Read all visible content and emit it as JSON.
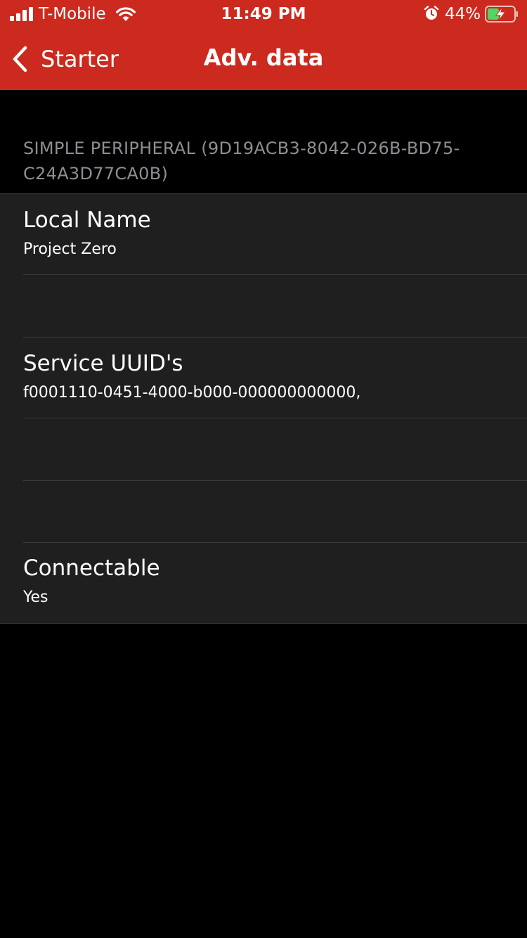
{
  "status_bar": {
    "carrier": "T-Mobile",
    "time": "11:49 PM",
    "battery_percent": "44%",
    "battery_level": 0.44,
    "icons": [
      "signal-icon",
      "wifi-icon",
      "alarm-icon",
      "battery-charging-icon"
    ]
  },
  "nav": {
    "back_label": "Starter",
    "title": "Adv. data"
  },
  "section": {
    "header_line1": "SIMPLE PERIPHERAL (9D19ACB3-8042-026B-BD75-",
    "header_line2": "C24A3D77CA0B)"
  },
  "rows": [
    {
      "title": "Local Name",
      "detail": "Project Zero"
    },
    {
      "title": "",
      "detail": ""
    },
    {
      "title": "Service UUID's",
      "detail": "f0001110-0451-4000-b000-000000000000,"
    },
    {
      "title": "",
      "detail": ""
    },
    {
      "title": "",
      "detail": ""
    },
    {
      "title": "Connectable",
      "detail": "Yes"
    }
  ],
  "colors": {
    "header": "#cc2a1e",
    "background": "#000000",
    "cell": "#1f1f1f",
    "separator": "#3a3a3c",
    "section_text": "#8e8e93",
    "battery_fill": "#4cd964"
  }
}
